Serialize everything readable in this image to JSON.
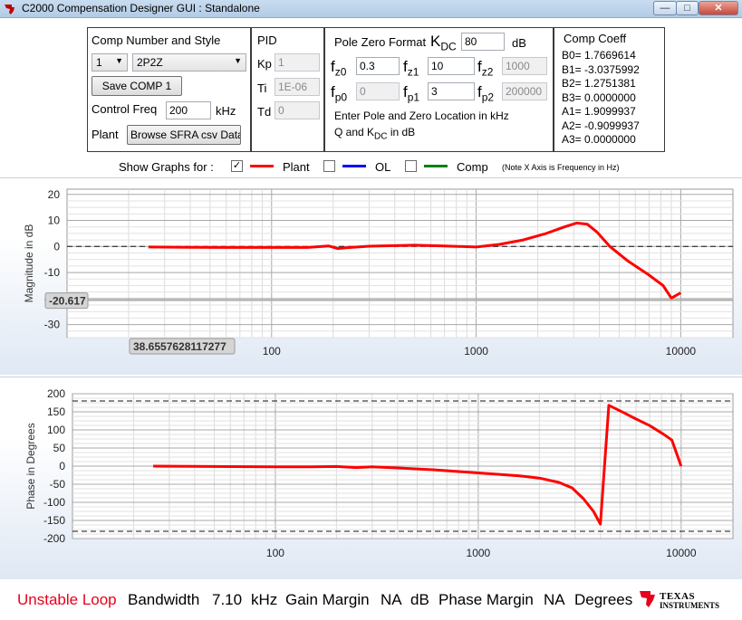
{
  "window": {
    "title": "C2000 Compensation Designer GUI : Standalone",
    "buttons": {
      "minimize": "—",
      "maximize": "□",
      "close": "✕"
    }
  },
  "comp": {
    "title": "Comp Number and Style",
    "number": "1",
    "style": "2P2Z",
    "save_label": "Save COMP 1",
    "control_freq_label": "Control Freq",
    "control_freq_value": "200",
    "control_freq_unit": "kHz",
    "plant_label": "Plant",
    "browse_label": "Browse SFRA csv Data"
  },
  "pid": {
    "title": "PID",
    "kp_label": "Kp",
    "kp_value": "1",
    "ti_label": "Ti",
    "ti_value": "1E-06",
    "td_label": "Td",
    "td_value": "0"
  },
  "pz": {
    "title": "Pole Zero Format",
    "kdc_main": "K",
    "kdc_sub": "DC",
    "kdc_value": "80",
    "kdc_unit": "dB",
    "f_main": "f",
    "fz0_sub": "z0",
    "fz0_value": "0.3",
    "fz1_sub": "z1",
    "fz1_value": "10",
    "fz2_sub": "z2",
    "fz2_value": "1000",
    "fp0_sub": "p0",
    "fp0_value": "0",
    "fp1_sub": "p1",
    "fp1_value": "3",
    "fp2_sub": "p2",
    "fp2_value": "200000",
    "note1": "Enter Pole and Zero Location in kHz",
    "note2_a": "Q and K",
    "note2_sub": "DC",
    "note2_b": " in dB"
  },
  "coeff": {
    "title": "Comp Coeff",
    "lines": [
      "B0= 1.7669614",
      "B1= -3.0375992",
      "B2= 1.2751381",
      "B3= 0.0000000",
      "A1= 1.9099937",
      "A2= -0.9099937",
      "A3= 0.0000000"
    ]
  },
  "graphs": {
    "label": "Show Graphs for :",
    "plant": {
      "label": "Plant",
      "checked": true,
      "color": "#ff0000"
    },
    "ol": {
      "label": "OL",
      "checked": false,
      "color": "#0000ff"
    },
    "comp": {
      "label": "Comp",
      "checked": false,
      "color": "#008000"
    },
    "note": "(Note X Axis is Frequency in Hz)",
    "check_mark": "✓"
  },
  "chart_data": [
    {
      "type": "line",
      "ylabel": "Magnitude in dB",
      "ylim": [
        -35,
        22
      ],
      "yticks": [
        20,
        10,
        0,
        -10,
        -20,
        -30
      ],
      "xscale": "log",
      "xlim": [
        10,
        18000
      ],
      "xticks": [
        100,
        1000,
        10000
      ],
      "xtick_labels": [
        "100",
        "1000",
        "10000"
      ],
      "reference_lines": [
        0
      ],
      "cursor": {
        "y_label": "-20.617",
        "x_label": "38.6557628117277",
        "y": -20.617,
        "x": 38.6557628117277
      },
      "series": [
        {
          "name": "Plant",
          "color": "#ff0000",
          "x": [
            25,
            40,
            60,
            100,
            150,
            190,
            210,
            230,
            300,
            500,
            700,
            1000,
            1300,
            1700,
            2200,
            2700,
            3100,
            3500,
            3900,
            4500,
            5500,
            7000,
            8200,
            9000,
            10000
          ],
          "y": [
            -0.2,
            -0.3,
            -0.4,
            -0.4,
            -0.4,
            0.2,
            -0.8,
            -0.5,
            0.1,
            0.5,
            0.2,
            -0.2,
            0.8,
            2.5,
            5.0,
            7.5,
            9.0,
            8.5,
            5.5,
            0.0,
            -5.5,
            -11.0,
            -15.0,
            -19.8,
            -17.8
          ]
        }
      ]
    },
    {
      "type": "line",
      "ylabel": "Phase in Degrees",
      "ylim": [
        -200,
        200
      ],
      "yticks": [
        200,
        150,
        100,
        50,
        0,
        -50,
        -100,
        -150,
        -200
      ],
      "xscale": "log",
      "xlim": [
        10,
        18000
      ],
      "xticks": [
        100,
        1000,
        10000
      ],
      "xtick_labels": [
        "100",
        "1000",
        "10000"
      ],
      "reference_lines": [
        180,
        -180
      ],
      "series": [
        {
          "name": "Plant",
          "color": "#ff0000",
          "x": [
            25,
            50,
            100,
            150,
            200,
            250,
            300,
            400,
            600,
            900,
            1200,
            1600,
            2000,
            2500,
            2900,
            3300,
            3700,
            4000,
            4400,
            5200,
            6000,
            7000,
            8200,
            9000,
            10000
          ],
          "y": [
            0,
            -1,
            -2,
            -2,
            -1,
            -4,
            -2,
            -5,
            -10,
            -17,
            -22,
            -27,
            -33,
            -45,
            -60,
            -90,
            -125,
            -160,
            168,
            148,
            130,
            112,
            88,
            72,
            0
          ]
        }
      ]
    }
  ],
  "status": {
    "loop_state": "Unstable Loop",
    "loop_color": "#e8001c",
    "bandwidth_label": "Bandwidth",
    "bandwidth_value": "7.10",
    "bandwidth_unit": "kHz",
    "gm_label": "Gain Margin",
    "gm_value": "NA",
    "gm_unit": "dB",
    "pm_label": "Phase Margin",
    "pm_value": "NA",
    "pm_unit": "Degrees",
    "brand_line1": "TEXAS",
    "brand_line2": "INSTRUMENTS",
    "brand_color": "#e8001c"
  }
}
